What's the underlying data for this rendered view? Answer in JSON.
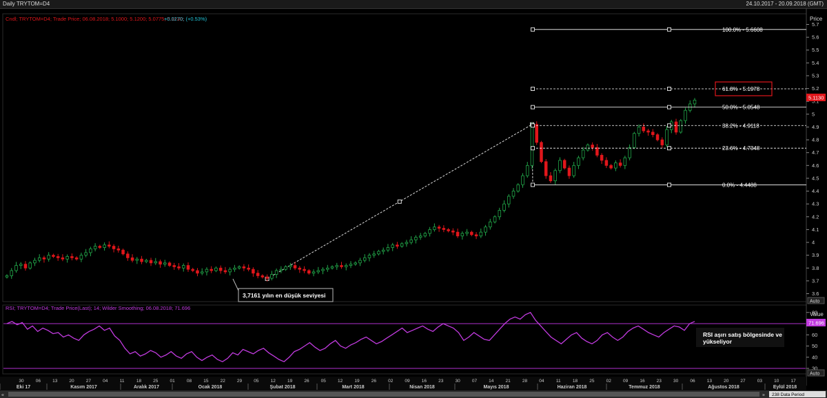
{
  "window": {
    "title": "Daily TRYTOM=D4",
    "date_range": "24.10.2017 - 20.09.2018 (GMT)"
  },
  "price_panel": {
    "legend": "Cndl; TRYTOM=D4; Trade Price; 06.08.2018; 5.1000; 5.1200; 5.0775; 5.1130;",
    "change": "+0.0270; (+0.53%)",
    "axis_title": "Price",
    "last_price": "5.1130",
    "auto_label": "Auto",
    "annotation_low": "3,7161 yılın en düşük seviyesi"
  },
  "rsi_panel": {
    "legend": "RSI; TRYTOM=D4; Trade Price(Last); 14; Wilder Smoothing; 06.08.2018; 71.696",
    "axis_title": "Value",
    "last_value": "71.696",
    "auto_label": "Auto",
    "annotation": "RSI aşırı satış bölgesinde ve yükseliyor"
  },
  "footer": {
    "data_period": "238 Data Period"
  },
  "colors": {
    "up": "#22a84a",
    "down": "#e0161b",
    "rsi_line": "#c23be0",
    "background": "#000000",
    "fib_line": "#ffffff",
    "highlight_box": "#e0161b"
  },
  "chart_data": {
    "type": "candlestick",
    "price_axis": {
      "ylim": [
        3.55,
        5.75
      ],
      "ticks": [
        "5.7",
        "5.6",
        "5.5",
        "5.4",
        "5.3",
        "5.2",
        "5.1",
        "5",
        "4.9",
        "4.8",
        "4.7",
        "4.6",
        "4.5",
        "4.4",
        "4.3",
        "4.2",
        "4.1",
        "4",
        "3.9",
        "3.8",
        "3.7",
        "3.6"
      ]
    },
    "rsi_axis": {
      "ylim": [
        25,
        85
      ],
      "ticks": [
        "80",
        "70",
        "60",
        "50",
        "40",
        "30"
      ],
      "overbought": 70,
      "oversold": 30
    },
    "date_ticks": [
      "30",
      "06",
      "13",
      "20",
      "27",
      "04",
      "11",
      "18",
      "25",
      "01",
      "08",
      "15",
      "22",
      "29",
      "05",
      "12",
      "19",
      "26",
      "05",
      "12",
      "19",
      "26",
      "02",
      "09",
      "16",
      "23",
      "30",
      "07",
      "14",
      "21",
      "28",
      "04",
      "11",
      "18",
      "25",
      "02",
      "09",
      "16",
      "23",
      "30",
      "06",
      "13",
      "20",
      "27",
      "03",
      "10",
      "17"
    ],
    "months": [
      "Eki 17",
      "Kasım 2017",
      "Aralık 2017",
      "Ocak 2018",
      "Şubat 2018",
      "Mart 2018",
      "Nisan 2018",
      "Mayıs 2018",
      "Haziran 2018",
      "Temmuz 2018",
      "Ağustos 2018",
      "Eylül 2018"
    ],
    "close_path": [
      3.74,
      3.78,
      3.82,
      3.83,
      3.8,
      3.84,
      3.86,
      3.88,
      3.87,
      3.9,
      3.89,
      3.88,
      3.87,
      3.89,
      3.88,
      3.87,
      3.9,
      3.92,
      3.95,
      3.97,
      3.96,
      3.98,
      3.97,
      3.95,
      3.94,
      3.91,
      3.88,
      3.86,
      3.87,
      3.85,
      3.86,
      3.84,
      3.85,
      3.83,
      3.84,
      3.82,
      3.81,
      3.8,
      3.82,
      3.79,
      3.78,
      3.76,
      3.77,
      3.79,
      3.78,
      3.8,
      3.78,
      3.77,
      3.79,
      3.8,
      3.81,
      3.8,
      3.79,
      3.76,
      3.74,
      3.73,
      3.72,
      3.75,
      3.78,
      3.79,
      3.81,
      3.82,
      3.8,
      3.79,
      3.78,
      3.76,
      3.77,
      3.78,
      3.79,
      3.8,
      3.81,
      3.82,
      3.81,
      3.82,
      3.83,
      3.84,
      3.86,
      3.88,
      3.9,
      3.91,
      3.93,
      3.94,
      3.96,
      3.98,
      3.97,
      3.99,
      4.0,
      4.02,
      4.04,
      4.05,
      4.07,
      4.1,
      4.12,
      4.11,
      4.1,
      4.09,
      4.08,
      4.05,
      4.07,
      4.08,
      4.06,
      4.05,
      4.08,
      4.12,
      4.16,
      4.2,
      4.25,
      4.3,
      4.36,
      4.4,
      4.45,
      4.52,
      4.6,
      4.92,
      4.78,
      4.63,
      4.52,
      4.48,
      4.56,
      4.64,
      4.58,
      4.52,
      4.6,
      4.66,
      4.72,
      4.76,
      4.74,
      4.68,
      4.64,
      4.6,
      4.58,
      4.62,
      4.6,
      4.66,
      4.74,
      4.85,
      4.9,
      4.87,
      4.86,
      4.84,
      4.8,
      4.76,
      4.88,
      4.94,
      4.86,
      4.95,
      5.03,
      5.08,
      5.11
    ],
    "rsi_values": [
      70,
      72,
      69,
      71,
      65,
      68,
      63,
      66,
      64,
      61,
      62,
      58,
      60,
      57,
      55,
      60,
      63,
      65,
      68,
      64,
      66,
      59,
      55,
      48,
      43,
      45,
      41,
      43,
      46,
      44,
      40,
      42,
      45,
      41,
      39,
      43,
      45,
      40,
      37,
      40,
      42,
      38,
      36,
      39,
      44,
      42,
      47,
      45,
      43,
      46,
      48,
      44,
      41,
      38,
      36,
      40,
      45,
      47,
      50,
      53,
      49,
      46,
      48,
      52,
      55,
      50,
      48,
      51,
      53,
      56,
      58,
      55,
      52,
      54,
      57,
      60,
      63,
      66,
      62,
      64,
      66,
      68,
      65,
      63,
      67,
      70,
      68,
      66,
      62,
      55,
      58,
      62,
      59,
      56,
      55,
      60,
      65,
      70,
      74,
      76,
      74,
      78,
      80,
      73,
      68,
      63,
      58,
      55,
      52,
      56,
      60,
      62,
      57,
      54,
      52,
      55,
      60,
      62,
      58,
      55,
      58,
      63,
      66,
      68,
      65,
      62,
      60,
      58,
      62,
      65,
      68,
      67,
      64,
      70,
      72
    ],
    "fibonacci": [
      {
        "level": "100.0%",
        "value": "5.6608"
      },
      {
        "level": "61.8%",
        "value": "5.1978"
      },
      {
        "level": "50.0%",
        "value": "5.0548"
      },
      {
        "level": "38.2%",
        "value": "4.9118"
      },
      {
        "level": "23.6%",
        "value": "4.7348"
      },
      {
        "level": "0.0%",
        "value": "4.4488"
      }
    ],
    "trendline": {
      "from": 3.7161,
      "to": 4.92
    }
  }
}
